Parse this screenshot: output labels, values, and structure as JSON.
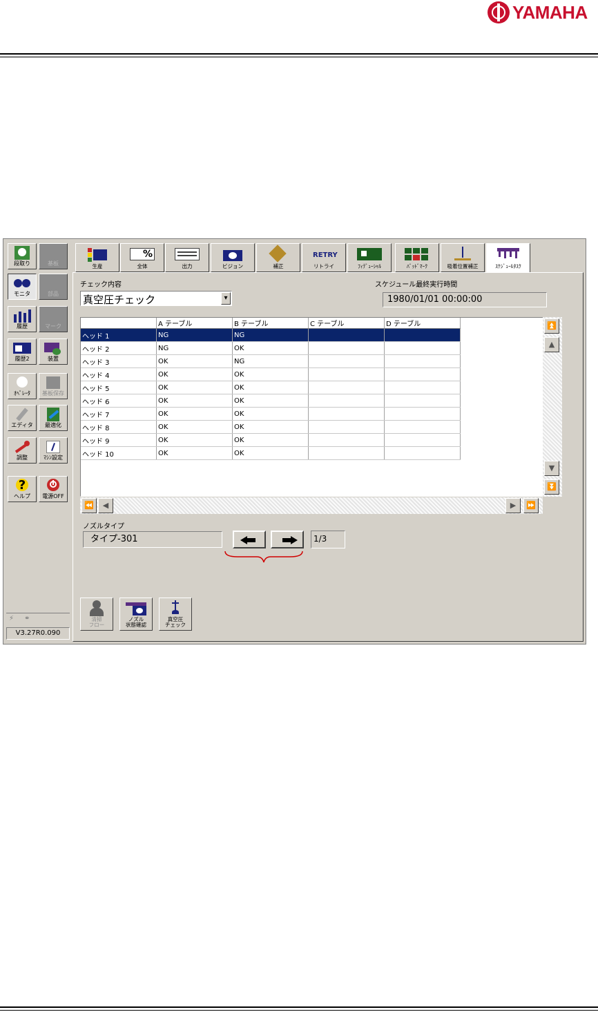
{
  "brand": {
    "name": "YAMAHA"
  },
  "sidebar": {
    "buttons": [
      {
        "label": "段取り"
      },
      {
        "label": "基板"
      },
      {
        "label": "モニタ"
      },
      {
        "label": "部品"
      },
      {
        "label": "履歴"
      },
      {
        "label": "マーク"
      },
      {
        "label": "履歴2"
      },
      {
        "label": "装置"
      },
      {
        "label": "ｵﾍﾟﾚｰﾀ"
      },
      {
        "label": "基板保存"
      },
      {
        "label": "エディタ"
      },
      {
        "label": "最適化"
      },
      {
        "label": "調整"
      },
      {
        "label": "ﾏｼﾝ設定"
      },
      {
        "label": "ヘルプ"
      },
      {
        "label": "電源OFF"
      }
    ],
    "version": "V3.27R0.090"
  },
  "tabs": [
    {
      "label": "生産"
    },
    {
      "label": "全体"
    },
    {
      "label": "出力"
    },
    {
      "label": "ビジョン"
    },
    {
      "label": "補正"
    },
    {
      "label": "リトライ"
    },
    {
      "label": "ﾌｨﾃﾞｭｰｼｬﾙ"
    },
    {
      "label": "ﾊﾞｯﾄﾞﾏｰｸ"
    },
    {
      "label": "吸着位置補正"
    },
    {
      "label": "ｽｹｼﾞｭｰﾙﾀｽｸ"
    }
  ],
  "check": {
    "label": "チェック内容",
    "value": "真空圧チェック",
    "dropdown_glyph": "▾"
  },
  "schedule": {
    "label": "スケジュール最終実行時間",
    "value": "1980/01/01 00:00:00"
  },
  "grid": {
    "columns": [
      "",
      "A テーブル",
      "B テーブル",
      "C テーブル",
      "D テーブル"
    ],
    "rows": [
      [
        "ヘッド 1",
        "NG",
        "NG",
        "",
        ""
      ],
      [
        "ヘッド 2",
        "NG",
        "OK",
        "",
        ""
      ],
      [
        "ヘッド 3",
        "OK",
        "NG",
        "",
        ""
      ],
      [
        "ヘッド 4",
        "OK",
        "OK",
        "",
        ""
      ],
      [
        "ヘッド 5",
        "OK",
        "OK",
        "",
        ""
      ],
      [
        "ヘッド 6",
        "OK",
        "OK",
        "",
        ""
      ],
      [
        "ヘッド 7",
        "OK",
        "OK",
        "",
        ""
      ],
      [
        "ヘッド 8",
        "OK",
        "OK",
        "",
        ""
      ],
      [
        "ヘッド 9",
        "OK",
        "OK",
        "",
        ""
      ],
      [
        "ヘッド 10",
        "OK",
        "OK",
        "",
        ""
      ]
    ],
    "scroll": {
      "top": "⏫",
      "up": "▲",
      "down": "▼",
      "bottom": "⏬",
      "first": "⏪",
      "left": "◀",
      "right": "▶",
      "last": "⏩"
    }
  },
  "nozzle": {
    "label": "ノズルタイプ",
    "value": "タイプ-301",
    "page": "1/3"
  },
  "functions": [
    {
      "label": "清掃\nフロー"
    },
    {
      "label": "ノズル\n状態確認"
    },
    {
      "label": "真空圧\nチェック"
    }
  ],
  "retry_text": "RETRY"
}
